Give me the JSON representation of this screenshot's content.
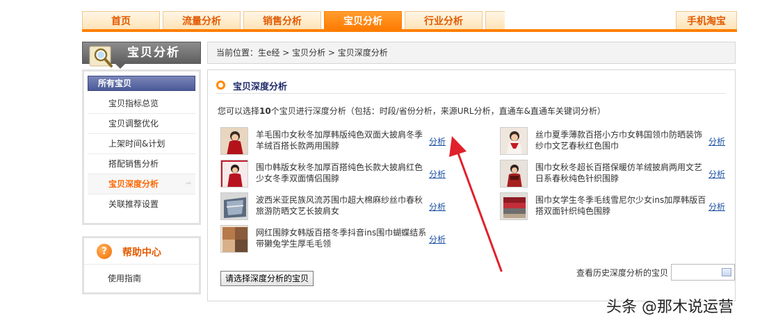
{
  "nav": {
    "tabs": [
      {
        "label": "首页"
      },
      {
        "label": "流量分析"
      },
      {
        "label": "销售分析"
      },
      {
        "label": "宝贝分析"
      },
      {
        "label": "行业分析"
      }
    ],
    "mobile_tab": "手机淘宝",
    "active_tab": "宝贝分析",
    "accent_color": "#ff7e00"
  },
  "sidebar": {
    "header_title": "宝贝分析",
    "menu_title": "所有宝贝",
    "items": [
      {
        "label": "宝贝指标总览"
      },
      {
        "label": "宝贝调整优化"
      },
      {
        "label": "上架时间&计划"
      },
      {
        "label": "搭配销售分析"
      },
      {
        "label": "宝贝深度分析"
      },
      {
        "label": "关联推荐设置"
      }
    ],
    "active_item": "宝贝深度分析",
    "help_title": "帮助中心",
    "help_link": "使用指南"
  },
  "breadcrumb": {
    "prefix": "当前位置：",
    "path": [
      "生e经",
      "宝贝分析",
      "宝贝深度分析"
    ],
    "separator": " > "
  },
  "main": {
    "section_title": "宝贝深度分析",
    "desc_before": "您可以选择",
    "desc_count": "10",
    "desc_after": "个宝贝进行深度分析（包括：时段/省份分析，来源URL分析，直通车&直通车关键词分析）",
    "analyze_label": "分析",
    "products": [
      {
        "name": "羊毛围巾女秋冬加厚韩版纯色双面大披肩冬季羊绒百搭长款两用围脖"
      },
      {
        "name": "丝巾夏季薄款百搭小方巾女韩国领巾防晒装饰纱巾文艺春秋红色围巾"
      },
      {
        "name": "围巾韩版女秋冬加厚百搭纯色长款大披肩红色少女冬季双面情侣围脖"
      },
      {
        "name": "围巾女秋冬超长百搭保暖仿羊绒披肩两用文艺日系春秋纯色针织围脖"
      },
      {
        "name": "波西米亚民族风流苏围巾超大棉麻纱丝巾春秋旅游防晒文艺长披肩女"
      },
      {
        "name": "围巾女学生冬季毛线雪尼尔少女ins加厚韩版百搭双面针织纯色围脖"
      },
      {
        "name": "网红围脖女韩版百搭冬季抖音ins围巾蝴蝶结系带獭兔学生厚毛毛领"
      }
    ],
    "select_button": "请选择深度分析的宝贝",
    "history_label": "查看历史深度分析的宝贝",
    "history_date_value": ""
  },
  "watermark": "头条 @那木说运营"
}
